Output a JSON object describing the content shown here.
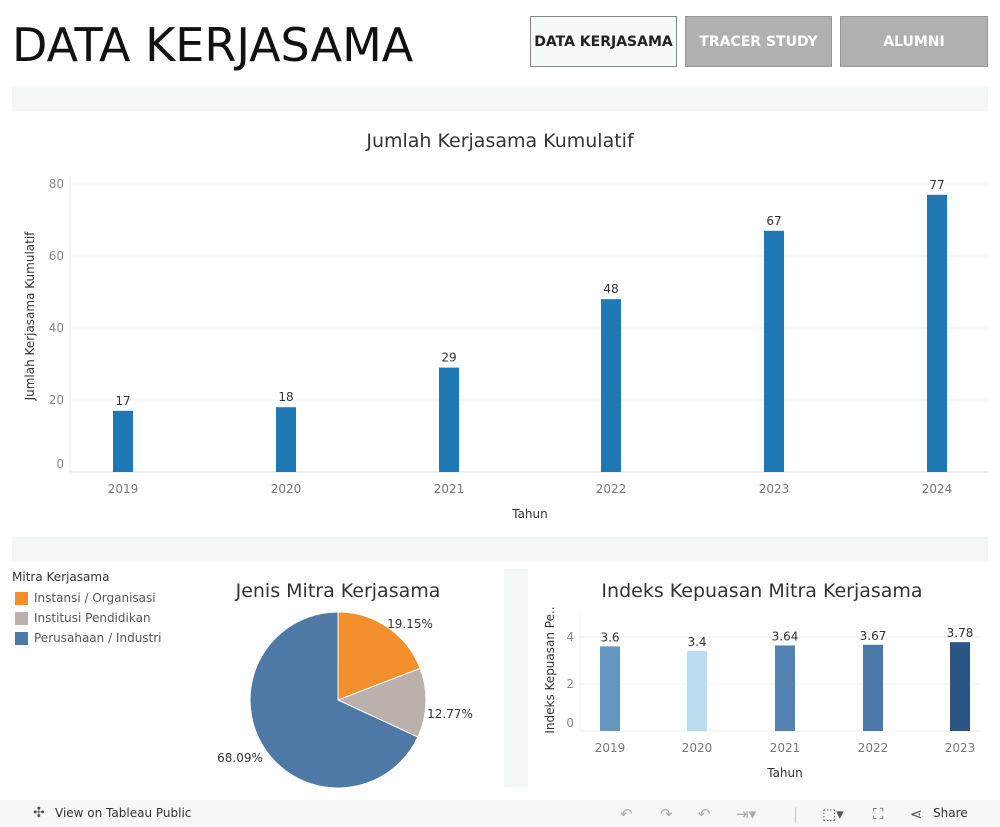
{
  "header": {
    "title": "DATA KERJASAMA",
    "nav": [
      "DATA KERJASAMA",
      "TRACER STUDY",
      "ALUMNI"
    ]
  },
  "colors": {
    "main_bar": "#1f77b4",
    "orange": "#f28e2b",
    "gray": "#bab0ac",
    "blue": "#4e79a7"
  },
  "chart_data": [
    {
      "type": "bar",
      "title": "Jumlah Kerjasama Kumulatif",
      "xlabel": "Tahun",
      "ylabel": "Jumlah Kerjasama Kumulatif",
      "categories": [
        "2019",
        "2020",
        "2021",
        "2022",
        "2023",
        "2024"
      ],
      "values": [
        17,
        18,
        29,
        48,
        67,
        77
      ],
      "ylim": [
        0,
        80
      ],
      "yticks": [
        0,
        20,
        40,
        60,
        80
      ],
      "grid": true
    },
    {
      "type": "pie",
      "title": "Jenis Mitra Kerjasama",
      "legend_title": "Mitra Kerjasama",
      "legend_placement": "left",
      "slices": [
        {
          "label": "Instansi / Organisasi",
          "value": 19.15,
          "text": "19.15%",
          "color": "#f28e2b"
        },
        {
          "label": "Institusi Pendidikan",
          "value": 12.77,
          "text": "12.77%",
          "color": "#bab0ac"
        },
        {
          "label": "Perusahaan / Industri",
          "value": 68.09,
          "text": "68.09%",
          "color": "#4e79a7"
        }
      ]
    },
    {
      "type": "bar",
      "title": "Indeks Kepuasan Mitra Kerjasama",
      "xlabel": "Tahun",
      "ylabel": "Indeks Kepuasan Pe..",
      "categories": [
        "2019",
        "2020",
        "2021",
        "2022",
        "2023"
      ],
      "values": [
        3.6,
        3.4,
        3.64,
        3.67,
        3.78
      ],
      "labels": [
        "3.6",
        "3.4",
        "3.64",
        "3.67",
        "3.78"
      ],
      "colors": [
        "#6596c0",
        "#b9ddf0",
        "#5382b2",
        "#4b79a9",
        "#2b5582"
      ],
      "ylim": [
        0,
        5
      ],
      "yticks": [
        0,
        2,
        4
      ],
      "grid": true
    }
  ],
  "footer": {
    "view": "View on Tableau Public",
    "share": "Share"
  }
}
